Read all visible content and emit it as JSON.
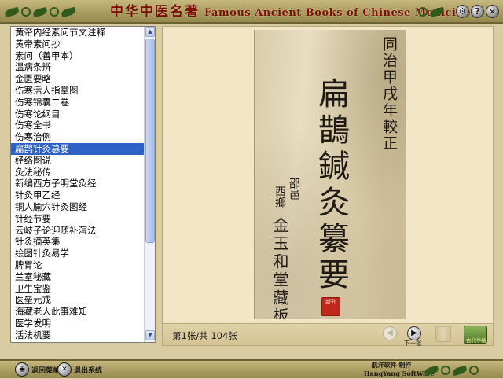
{
  "titlebar": {
    "title_cn": "中华中医名著",
    "title_en": "Famous Ancient Books of Chinese Medicine",
    "buttons": [
      {
        "name": "settings",
        "glyph": "⚙"
      },
      {
        "name": "help",
        "glyph": "?"
      },
      {
        "name": "close",
        "glyph": "×"
      }
    ]
  },
  "book_list": {
    "items": [
      "黄帝内经素问节文注释",
      "黄帝素问抄",
      "素问（善甲本）",
      "温病条辨",
      "金匮要略",
      "伤寒活人指掌图",
      "伤寒锦囊二卷",
      "伤寒论纲目",
      "伤寒全书",
      "伤寒治例",
      "扁鹊针灸篡要",
      "经络图说",
      "灸法秘传",
      "新编西方子明堂灸经",
      "针灸甲乙经",
      "铜人腧穴针灸图经",
      "针经节要",
      "云岐子论迎随补泻法",
      "针灸摘英集",
      "绘图针灸易学",
      "脾胃论",
      "兰室秘藏",
      "卫生宝鉴",
      "医垒元戎",
      "海藏老人此事难知",
      "医学发明",
      "活法机要"
    ],
    "selected_index": 10
  },
  "scan": {
    "right_column": "同治甲戌年較正",
    "main_title": "扁鵲鍼灸纂要",
    "left_column_top": "邵邑",
    "left_column_bottom": "西鄉",
    "left_column_main": "金玉和堂藏板",
    "seal_text": "新刊"
  },
  "viewer": {
    "page_info": "第1张/共 104张",
    "next_label": "下一张",
    "gudai_label": "古代手稿"
  },
  "bottombar": {
    "menu_label": "返回菜单",
    "exit_label": "退出系统",
    "company_cn": "航洋软件 制作",
    "company_en": "HangYang SoftWare"
  }
}
